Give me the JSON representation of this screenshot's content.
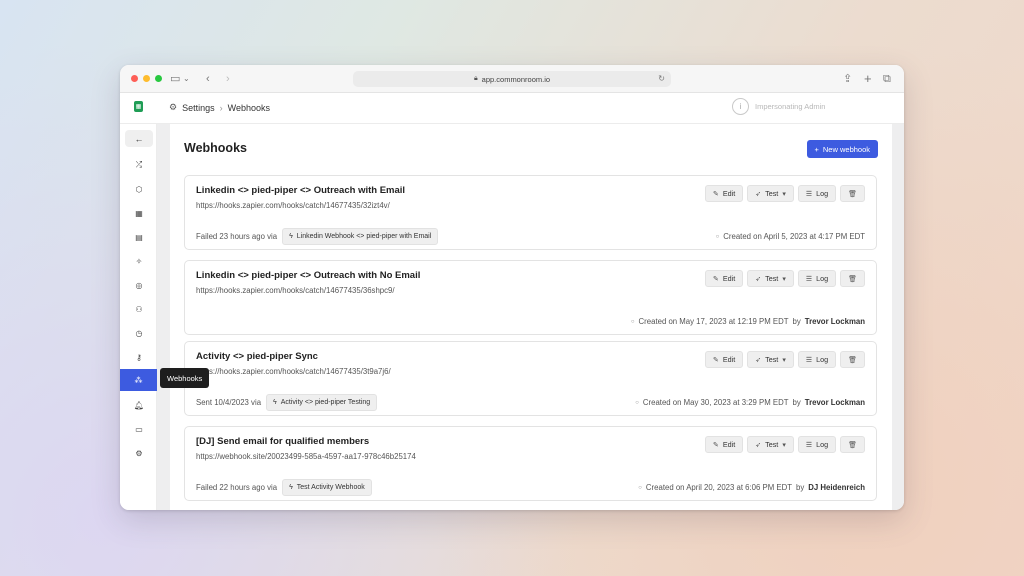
{
  "browser": {
    "url": "app.commonroom.io"
  },
  "topbar": {
    "breadcrumb": [
      "Settings",
      "Webhooks"
    ],
    "impersonation_label": "Impersonating Admin"
  },
  "sidebar": {
    "tooltip": "Webhooks",
    "items": [
      "activity",
      "tags",
      "apps",
      "reports",
      "workflows",
      "segments",
      "members",
      "history",
      "keys",
      "webhooks",
      "alerts",
      "display",
      "settings"
    ],
    "active": "webhooks"
  },
  "page": {
    "title": "Webhooks",
    "new_button": "New webhook"
  },
  "actions": {
    "edit": "Edit",
    "test": "Test",
    "log": "Log"
  },
  "webhooks": [
    {
      "title": "Linkedin <> pied-piper <> Outreach with Email",
      "url": "https://hooks.zapier.com/hooks/catch/14677435/32izt4v/",
      "status": "Failed 23 hours ago via",
      "trigger": "Linkedin Webhook <> pied-piper with Email",
      "created": "Created on April 5, 2023 at 4:17 PM EDT",
      "by_prefix": "",
      "author": ""
    },
    {
      "title": "Linkedin <> pied-piper <> Outreach with No Email",
      "url": "https://hooks.zapier.com/hooks/catch/14677435/36shpc9/",
      "status": "",
      "trigger": "",
      "created": "Created on May 17, 2023 at 12:19 PM EDT",
      "by_prefix": "by",
      "author": "Trevor Lockman"
    },
    {
      "title": "Activity <> pied-piper Sync",
      "url": "https://hooks.zapier.com/hooks/catch/14677435/3t9a7j6/",
      "status": "Sent 10/4/2023 via",
      "trigger": "Activity <> pied-piper Testing",
      "created": "Created on May 30, 2023 at 3:29 PM EDT",
      "by_prefix": "by",
      "author": "Trevor Lockman"
    },
    {
      "title": "[DJ] Send email for qualified members",
      "url": "https://webhook.site/20023499-585a-4597-aa17-978c46b25174",
      "status": "Failed 22 hours ago via",
      "trigger": "Test Activity Webhook",
      "created": "Created on April 20, 2023 at 6:06 PM EDT",
      "by_prefix": "by",
      "author": "DJ Heidenreich"
    }
  ]
}
